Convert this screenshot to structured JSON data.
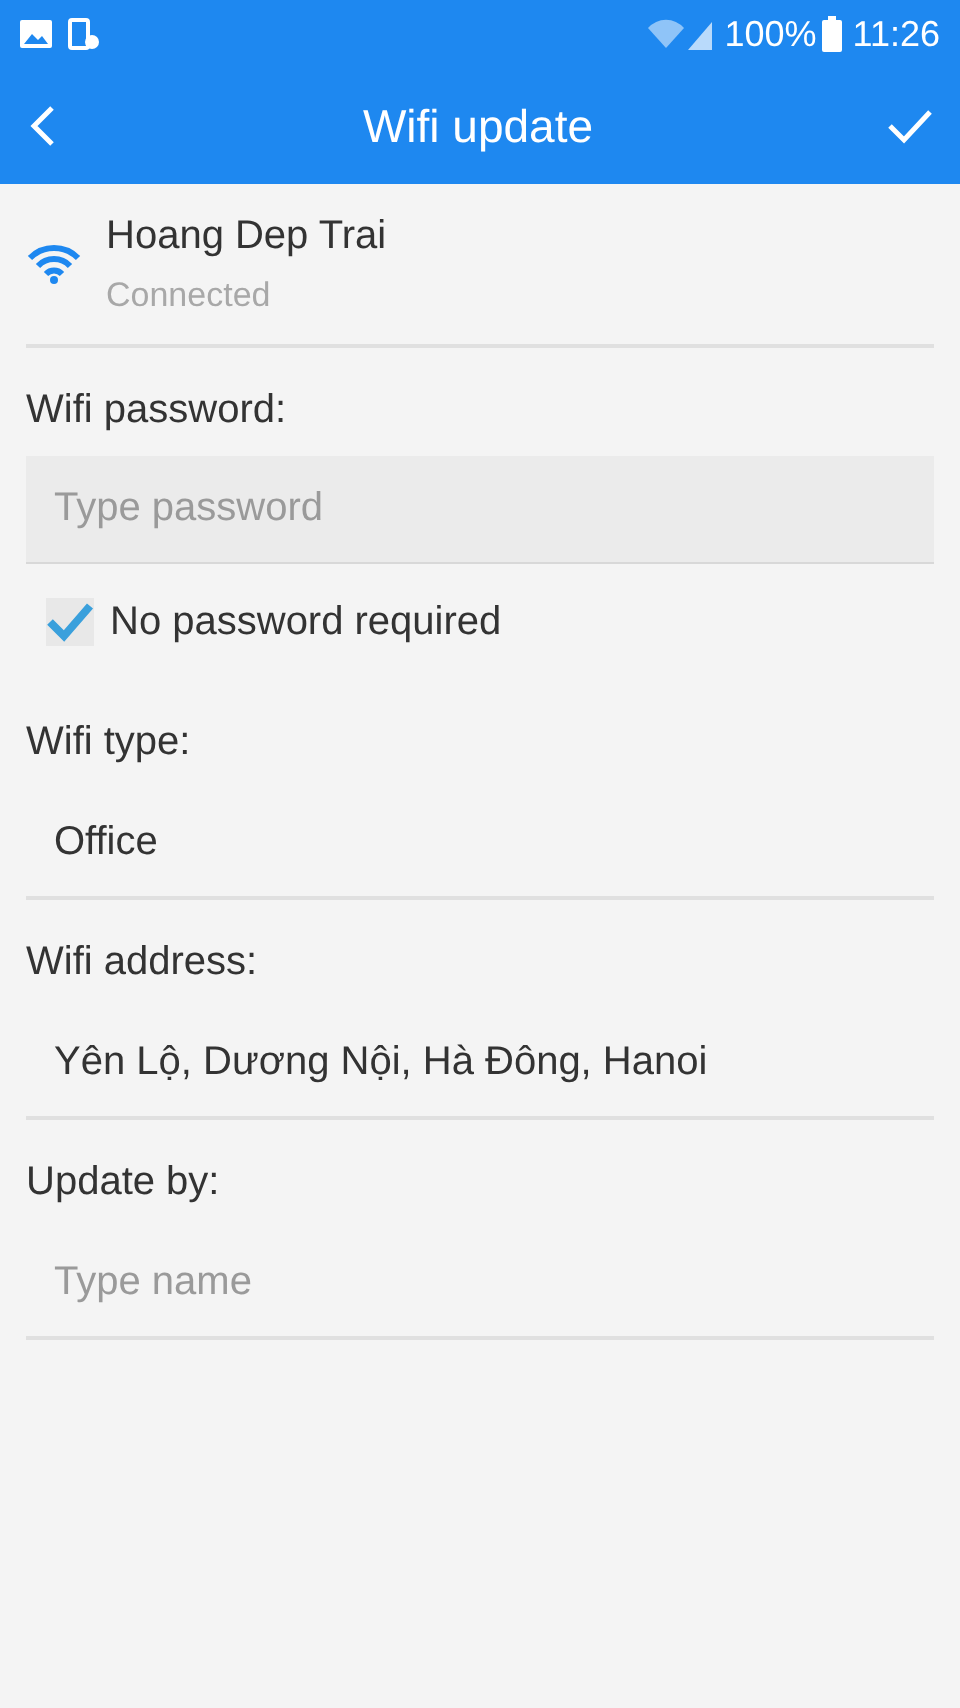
{
  "status_bar": {
    "battery": "100%",
    "time": "11:26"
  },
  "app_bar": {
    "title": "Wifi update"
  },
  "network": {
    "name": "Hoang Dep Trai",
    "status": "Connected"
  },
  "sections": [
    {
      "label": "Wifi password:",
      "field": {
        "kind": "filled",
        "placeholder": "Type password"
      },
      "checkbox": {
        "label": "No password required",
        "checked": true
      }
    },
    {
      "label": "Wifi type:",
      "field": {
        "kind": "underline",
        "value": "Office"
      }
    },
    {
      "label": "Wifi address:",
      "field": {
        "kind": "underline",
        "value": "Yên Lộ, Dương Nội, Hà Đông, Hanoi"
      }
    },
    {
      "label": "Update by:",
      "field": {
        "kind": "underline",
        "placeholder": "Type name"
      }
    }
  ]
}
